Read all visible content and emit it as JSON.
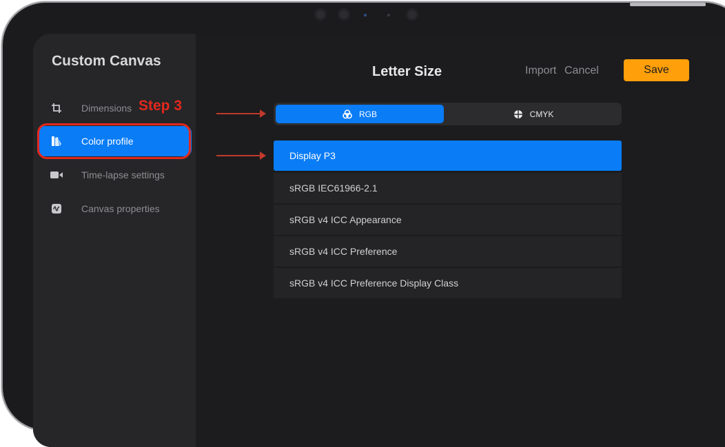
{
  "sidebar": {
    "title": "Custom Canvas",
    "items": [
      {
        "label": "Dimensions",
        "icon": "crop-icon"
      },
      {
        "label": "Color profile",
        "icon": "color-profile-icon"
      },
      {
        "label": "Time-lapse settings",
        "icon": "video-camera-icon"
      },
      {
        "label": "Canvas properties",
        "icon": "canvas-properties-icon"
      }
    ]
  },
  "annotation": {
    "step_label": "Step 3",
    "color": "#e3281d"
  },
  "header": {
    "title": "Letter Size",
    "import_label": "Import",
    "cancel_label": "Cancel",
    "save_label": "Save",
    "save_color": "#ff9f0a"
  },
  "color_mode": {
    "options": [
      {
        "label": "RGB",
        "icon": "rgb-icon",
        "selected": true
      },
      {
        "label": "CMYK",
        "icon": "cmyk-icon",
        "selected": false
      }
    ],
    "accent": "#0a7cf6"
  },
  "profiles": [
    {
      "label": "Display P3",
      "selected": true
    },
    {
      "label": "sRGB IEC61966-2.1",
      "selected": false
    },
    {
      "label": "sRGB v4 ICC Appearance",
      "selected": false
    },
    {
      "label": "sRGB v4 ICC Preference",
      "selected": false
    },
    {
      "label": "sRGB v4 ICC Preference Display Class",
      "selected": false
    }
  ]
}
